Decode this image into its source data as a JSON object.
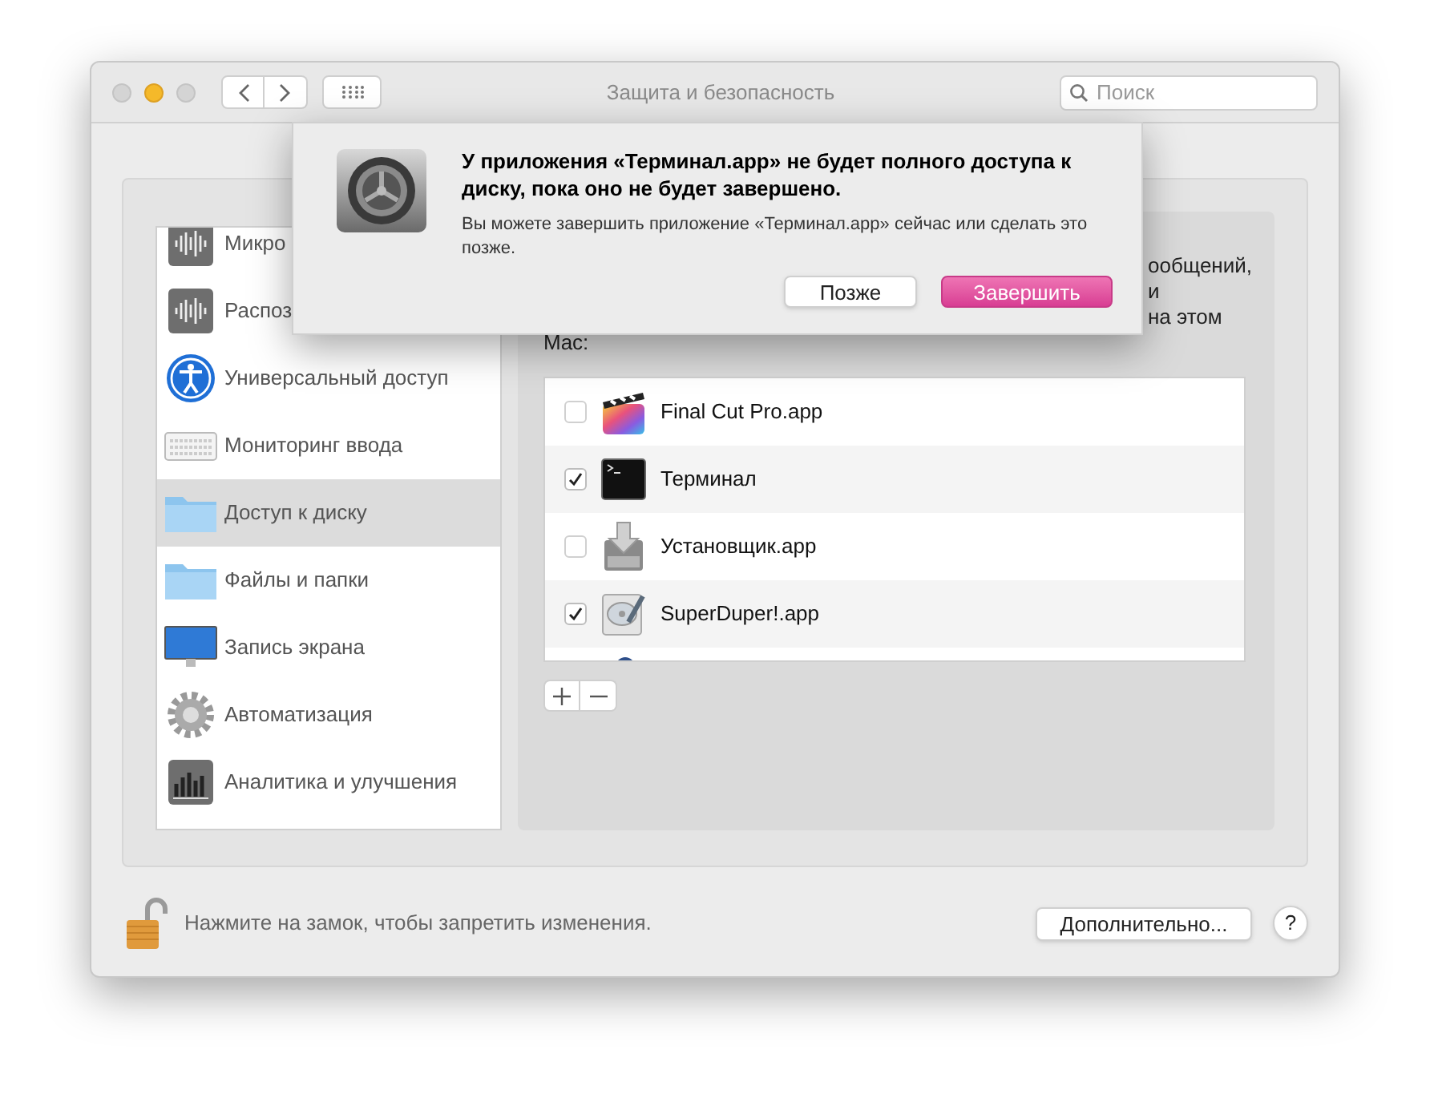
{
  "window": {
    "title": "Защита и безопасность"
  },
  "search": {
    "placeholder": "Поиск"
  },
  "sidebar": {
    "items": [
      {
        "label": "Микро",
        "selected": false
      },
      {
        "label": "Распоз",
        "selected": false
      },
      {
        "label": "Универсальный доступ",
        "selected": false
      },
      {
        "label": "Мониторинг ввода",
        "selected": false
      },
      {
        "label": "Доступ к диску",
        "selected": true
      },
      {
        "label": "Файлы и папки",
        "selected": false
      },
      {
        "label": "Запись экрана",
        "selected": false
      },
      {
        "label": "Автоматизация",
        "selected": false
      },
      {
        "label": "Аналитика и улучшения",
        "selected": false
      }
    ]
  },
  "panel": {
    "description_fragments": [
      "ообщений,",
      "и",
      "на этом",
      "Mac:"
    ],
    "apps": [
      {
        "name": "Final Cut Pro.app",
        "checked": false
      },
      {
        "name": "Терминал",
        "checked": true
      },
      {
        "name": "Установщик.app",
        "checked": false
      },
      {
        "name": "SuperDuper!.app",
        "checked": true
      }
    ]
  },
  "footer": {
    "lock_text": "Нажмите на замок, чтобы запретить изменения.",
    "advanced_button": "Дополнительно...",
    "help": "?"
  },
  "dialog": {
    "title": "У приложения «Терминал.app» не будет полного доступа к диску, пока оно не будет завершено.",
    "message": "Вы можете завершить приложение «Терминал.app» сейчас или сделать это позже.",
    "buttons": [
      {
        "label": "Позже",
        "kind": "secondary"
      },
      {
        "label": "Завершить",
        "kind": "default"
      }
    ]
  }
}
